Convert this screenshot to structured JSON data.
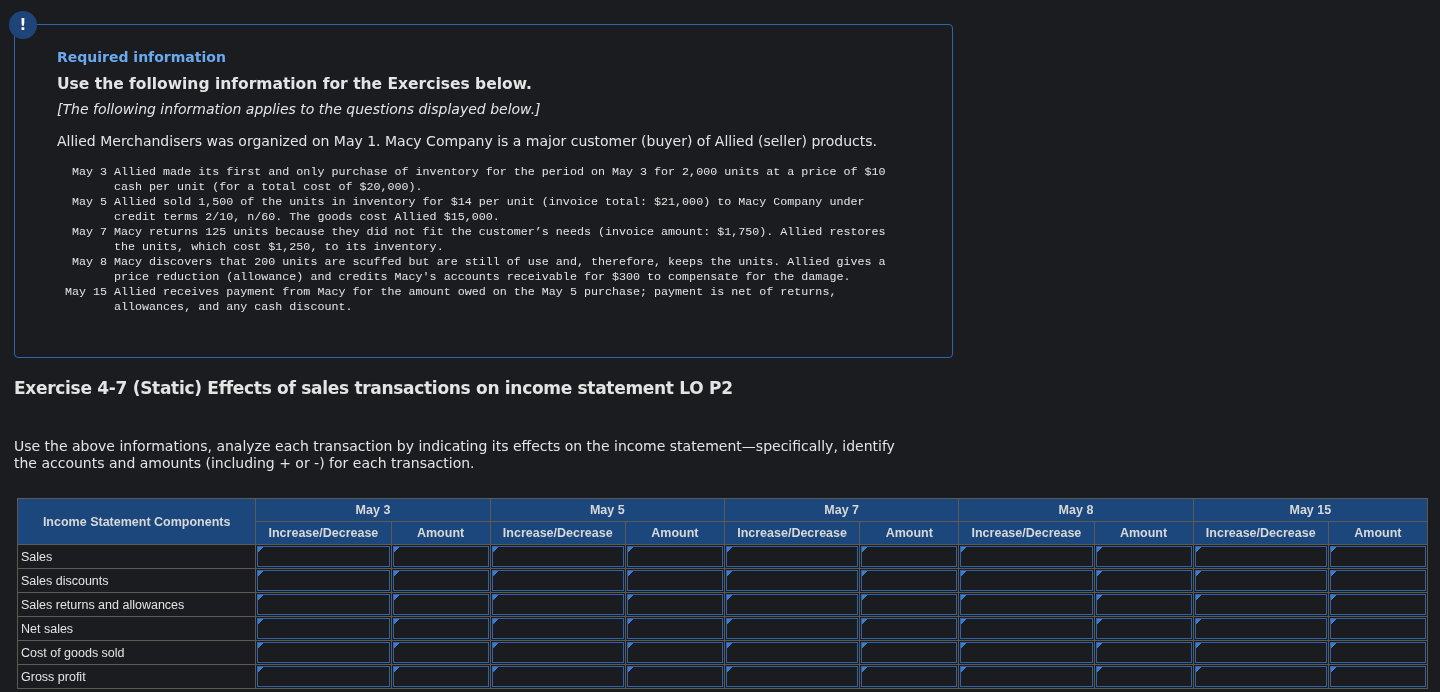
{
  "info_box": {
    "badge": "!",
    "heading": "Required information",
    "title": "Use the following information for the Exercises below.",
    "note": "[The following information applies to the questions displayed below.]",
    "intro": "Allied Merchandisers was organized on May 1. Macy Company is a major customer (buyer) of Allied (seller) products.",
    "transactions": [
      {
        "date": "May 3",
        "text": "Allied made its first and only purchase of inventory for the period on May 3 for 2,000 units at a price of $10 cash per unit (for a total cost of $20,000)."
      },
      {
        "date": "May 5",
        "text": "Allied sold 1,500 of the units in inventory for $14 per unit (invoice total: $21,000) to Macy Company under credit terms 2/10, n/60. The goods cost Allied $15,000."
      },
      {
        "date": "May 7",
        "text": "Macy returns 125 units because they did not fit the customer’s needs (invoice amount: $1,750). Allied restores the units, which cost $1,250, to its inventory."
      },
      {
        "date": "May 8",
        "text": "Macy discovers that 200 units are scuffed but are still of use and, therefore, keeps the units. Allied gives a price reduction (allowance) and credits Macy's accounts receivable for $300 to compensate for the damage."
      },
      {
        "date": "May 15",
        "text": "Allied receives payment from Macy for the amount owed on the May 5 purchase; payment is net of returns, allowances, and any cash discount."
      }
    ]
  },
  "exercise": {
    "title": "Exercise 4-7 (Static) Effects of sales transactions on income statement LO P2",
    "instructions": "Use the above informations, analyze each transaction by indicating its effects on the income statement—specifically, identify the accounts and amounts (including + or -) for each transaction."
  },
  "table": {
    "first_header": "Income Statement Components",
    "groups": [
      {
        "date": "May 3",
        "columns": [
          "Increase/Decrease",
          "Amount"
        ]
      },
      {
        "date": "May 5",
        "columns": [
          "Increase/Decrease",
          "Amount"
        ]
      },
      {
        "date": "May 7",
        "columns": [
          "Increase/Decrease",
          "Amount"
        ]
      },
      {
        "date": "May 8",
        "columns": [
          "Increase/Decrease",
          "Amount"
        ]
      },
      {
        "date": "May 15",
        "columns": [
          "Increase/Decrease",
          "Amount"
        ]
      }
    ],
    "rows": [
      "Sales",
      "Sales discounts",
      "Sales returns and allowances",
      "Net sales",
      "Cost of goods sold",
      "Gross profit"
    ]
  }
}
